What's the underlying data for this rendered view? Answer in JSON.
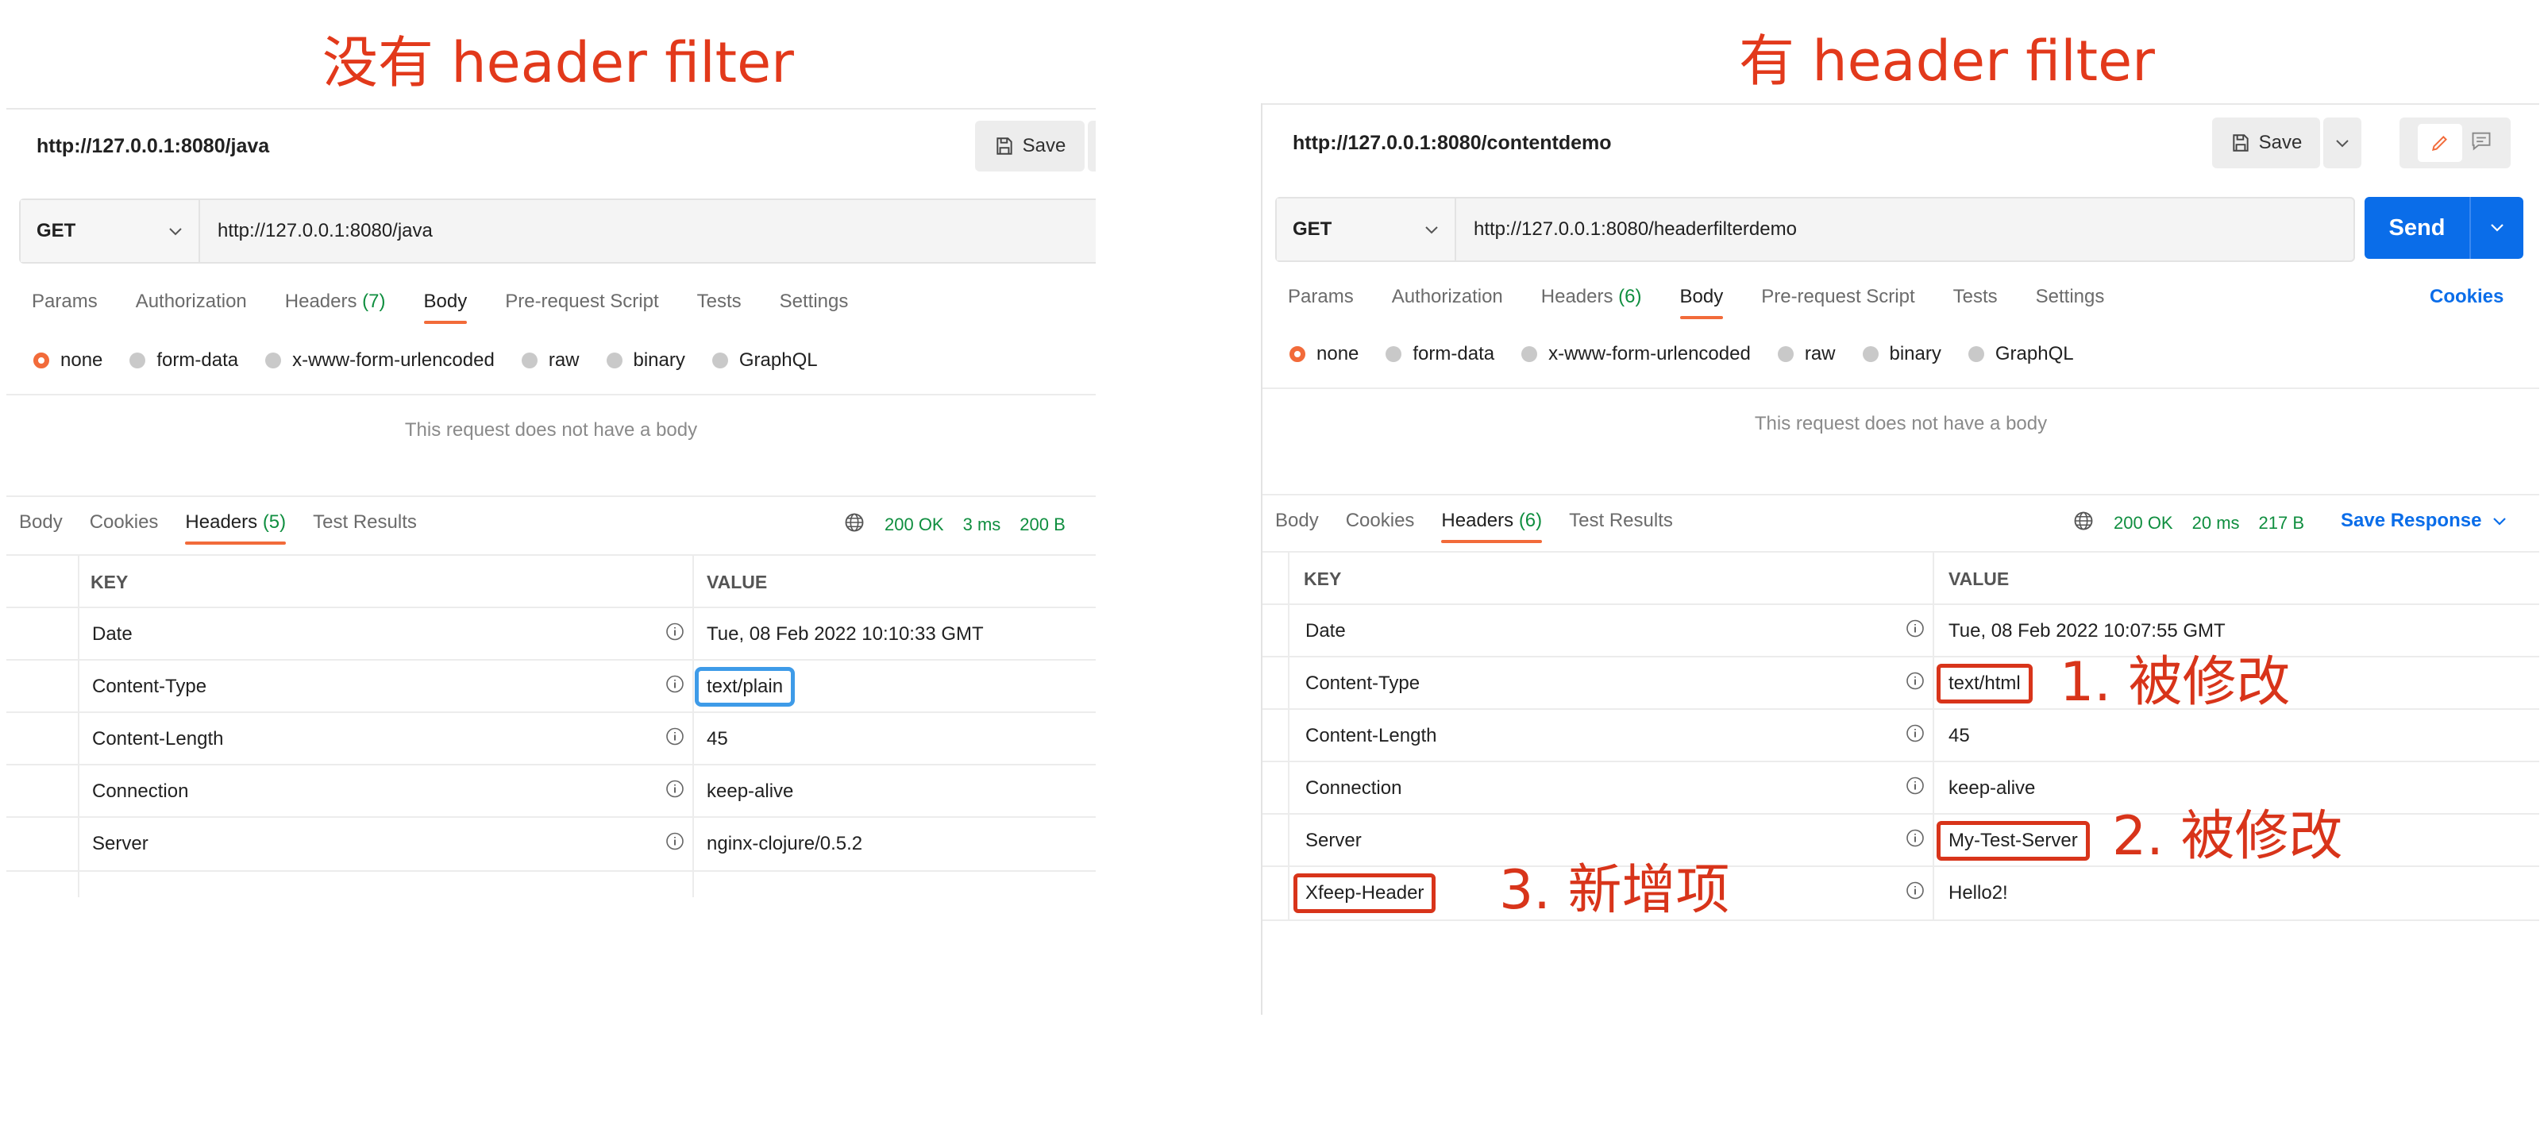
{
  "captions": {
    "left": "没有 header filter",
    "right": "有 header filter"
  },
  "left": {
    "title": "http://127.0.0.1:8080/java",
    "save_label": "Save",
    "method": "GET",
    "url": "http://127.0.0.1:8080/java",
    "tabs": [
      {
        "label": "Params"
      },
      {
        "label": "Authorization"
      },
      {
        "label": "Headers",
        "count": "(7)"
      },
      {
        "label": "Body"
      },
      {
        "label": "Pre-request Script"
      },
      {
        "label": "Tests"
      },
      {
        "label": "Settings"
      }
    ],
    "body_types": [
      "none",
      "form-data",
      "x-www-form-urlencoded",
      "raw",
      "binary",
      "GraphQL"
    ],
    "no_body_text": "This request does not have a body",
    "resp_tabs": [
      {
        "label": "Body"
      },
      {
        "label": "Cookies"
      },
      {
        "label": "Headers",
        "count": "(5)"
      },
      {
        "label": "Test Results"
      }
    ],
    "status": {
      "code": "200 OK",
      "time": "3 ms",
      "size": "200 B"
    },
    "table": {
      "key_header": "KEY",
      "value_header": "VALUE",
      "rows": [
        {
          "key": "Date",
          "value": "Tue, 08 Feb 2022 10:10:33 GMT"
        },
        {
          "key": "Content-Type",
          "value": "text/plain"
        },
        {
          "key": "Content-Length",
          "value": "45"
        },
        {
          "key": "Connection",
          "value": "keep-alive"
        },
        {
          "key": "Server",
          "value": "nginx-clojure/0.5.2"
        }
      ]
    }
  },
  "right": {
    "title": "http://127.0.0.1:8080/contentdemo",
    "save_label": "Save",
    "method": "GET",
    "url": "http://127.0.0.1:8080/headerfilterdemo",
    "send_label": "Send",
    "tabs": [
      {
        "label": "Params"
      },
      {
        "label": "Authorization"
      },
      {
        "label": "Headers",
        "count": "(6)"
      },
      {
        "label": "Body"
      },
      {
        "label": "Pre-request Script"
      },
      {
        "label": "Tests"
      },
      {
        "label": "Settings"
      }
    ],
    "cookies_label": "Cookies",
    "body_types": [
      "none",
      "form-data",
      "x-www-form-urlencoded",
      "raw",
      "binary",
      "GraphQL"
    ],
    "no_body_text": "This request does not have a body",
    "resp_tabs": [
      {
        "label": "Body"
      },
      {
        "label": "Cookies"
      },
      {
        "label": "Headers",
        "count": "(6)"
      },
      {
        "label": "Test Results"
      }
    ],
    "status": {
      "code": "200 OK",
      "time": "20 ms",
      "size": "217 B"
    },
    "save_response_label": "Save Response",
    "table": {
      "key_header": "KEY",
      "value_header": "VALUE",
      "rows": [
        {
          "key": "Date",
          "value": "Tue, 08 Feb 2022 10:07:55 GMT"
        },
        {
          "key": "Content-Type",
          "value": "text/html"
        },
        {
          "key": "Content-Length",
          "value": "45"
        },
        {
          "key": "Connection",
          "value": "keep-alive"
        },
        {
          "key": "Server",
          "value": "My-Test-Server"
        },
        {
          "key": "Xfeep-Header",
          "value": "Hello2!"
        }
      ]
    }
  },
  "annotations": {
    "modified_1": "1. 被修改",
    "modified_2": "2. 被修改",
    "new_item": "3. 新增项"
  },
  "colors": {
    "annotation_red": "#e2391b",
    "highlight_blue": "#3e9be8",
    "accent_orange": "#f26b3a",
    "send_blue": "#0a6de9",
    "status_green": "#0f8e3f"
  }
}
